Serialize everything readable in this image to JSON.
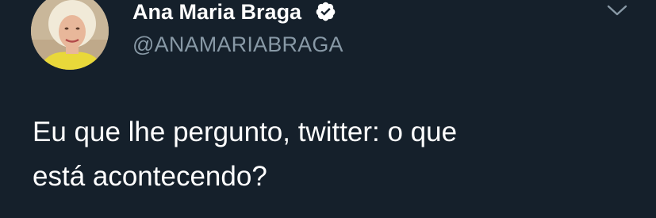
{
  "tweet": {
    "author": {
      "display_name": "Ana Maria Braga",
      "handle": "@ANAMARIABRAGA",
      "verified": true,
      "avatar_icon": "profile-photo"
    },
    "text_lines": [
      "Eu que lhe pergunto, twitter: o que",
      "está acontecendo?"
    ],
    "menu_icon": "chevron-down-icon"
  },
  "colors": {
    "background": "#15202b",
    "text_primary": "#ffffff",
    "text_secondary": "#8899a6",
    "icon_muted": "#8899a6"
  }
}
